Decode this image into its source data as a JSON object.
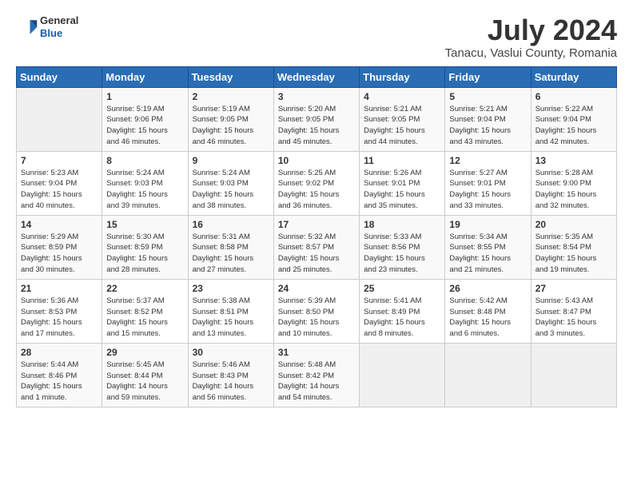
{
  "header": {
    "logo_general": "General",
    "logo_blue": "Blue",
    "month_year": "July 2024",
    "location": "Tanacu, Vaslui County, Romania"
  },
  "weekdays": [
    "Sunday",
    "Monday",
    "Tuesday",
    "Wednesday",
    "Thursday",
    "Friday",
    "Saturday"
  ],
  "weeks": [
    [
      {
        "day": "",
        "info": ""
      },
      {
        "day": "1",
        "info": "Sunrise: 5:19 AM\nSunset: 9:06 PM\nDaylight: 15 hours\nand 46 minutes."
      },
      {
        "day": "2",
        "info": "Sunrise: 5:19 AM\nSunset: 9:05 PM\nDaylight: 15 hours\nand 46 minutes."
      },
      {
        "day": "3",
        "info": "Sunrise: 5:20 AM\nSunset: 9:05 PM\nDaylight: 15 hours\nand 45 minutes."
      },
      {
        "day": "4",
        "info": "Sunrise: 5:21 AM\nSunset: 9:05 PM\nDaylight: 15 hours\nand 44 minutes."
      },
      {
        "day": "5",
        "info": "Sunrise: 5:21 AM\nSunset: 9:04 PM\nDaylight: 15 hours\nand 43 minutes."
      },
      {
        "day": "6",
        "info": "Sunrise: 5:22 AM\nSunset: 9:04 PM\nDaylight: 15 hours\nand 42 minutes."
      }
    ],
    [
      {
        "day": "7",
        "info": "Sunrise: 5:23 AM\nSunset: 9:04 PM\nDaylight: 15 hours\nand 40 minutes."
      },
      {
        "day": "8",
        "info": "Sunrise: 5:24 AM\nSunset: 9:03 PM\nDaylight: 15 hours\nand 39 minutes."
      },
      {
        "day": "9",
        "info": "Sunrise: 5:24 AM\nSunset: 9:03 PM\nDaylight: 15 hours\nand 38 minutes."
      },
      {
        "day": "10",
        "info": "Sunrise: 5:25 AM\nSunset: 9:02 PM\nDaylight: 15 hours\nand 36 minutes."
      },
      {
        "day": "11",
        "info": "Sunrise: 5:26 AM\nSunset: 9:01 PM\nDaylight: 15 hours\nand 35 minutes."
      },
      {
        "day": "12",
        "info": "Sunrise: 5:27 AM\nSunset: 9:01 PM\nDaylight: 15 hours\nand 33 minutes."
      },
      {
        "day": "13",
        "info": "Sunrise: 5:28 AM\nSunset: 9:00 PM\nDaylight: 15 hours\nand 32 minutes."
      }
    ],
    [
      {
        "day": "14",
        "info": "Sunrise: 5:29 AM\nSunset: 8:59 PM\nDaylight: 15 hours\nand 30 minutes."
      },
      {
        "day": "15",
        "info": "Sunrise: 5:30 AM\nSunset: 8:59 PM\nDaylight: 15 hours\nand 28 minutes."
      },
      {
        "day": "16",
        "info": "Sunrise: 5:31 AM\nSunset: 8:58 PM\nDaylight: 15 hours\nand 27 minutes."
      },
      {
        "day": "17",
        "info": "Sunrise: 5:32 AM\nSunset: 8:57 PM\nDaylight: 15 hours\nand 25 minutes."
      },
      {
        "day": "18",
        "info": "Sunrise: 5:33 AM\nSunset: 8:56 PM\nDaylight: 15 hours\nand 23 minutes."
      },
      {
        "day": "19",
        "info": "Sunrise: 5:34 AM\nSunset: 8:55 PM\nDaylight: 15 hours\nand 21 minutes."
      },
      {
        "day": "20",
        "info": "Sunrise: 5:35 AM\nSunset: 8:54 PM\nDaylight: 15 hours\nand 19 minutes."
      }
    ],
    [
      {
        "day": "21",
        "info": "Sunrise: 5:36 AM\nSunset: 8:53 PM\nDaylight: 15 hours\nand 17 minutes."
      },
      {
        "day": "22",
        "info": "Sunrise: 5:37 AM\nSunset: 8:52 PM\nDaylight: 15 hours\nand 15 minutes."
      },
      {
        "day": "23",
        "info": "Sunrise: 5:38 AM\nSunset: 8:51 PM\nDaylight: 15 hours\nand 13 minutes."
      },
      {
        "day": "24",
        "info": "Sunrise: 5:39 AM\nSunset: 8:50 PM\nDaylight: 15 hours\nand 10 minutes."
      },
      {
        "day": "25",
        "info": "Sunrise: 5:41 AM\nSunset: 8:49 PM\nDaylight: 15 hours\nand 8 minutes."
      },
      {
        "day": "26",
        "info": "Sunrise: 5:42 AM\nSunset: 8:48 PM\nDaylight: 15 hours\nand 6 minutes."
      },
      {
        "day": "27",
        "info": "Sunrise: 5:43 AM\nSunset: 8:47 PM\nDaylight: 15 hours\nand 3 minutes."
      }
    ],
    [
      {
        "day": "28",
        "info": "Sunrise: 5:44 AM\nSunset: 8:46 PM\nDaylight: 15 hours\nand 1 minute."
      },
      {
        "day": "29",
        "info": "Sunrise: 5:45 AM\nSunset: 8:44 PM\nDaylight: 14 hours\nand 59 minutes."
      },
      {
        "day": "30",
        "info": "Sunrise: 5:46 AM\nSunset: 8:43 PM\nDaylight: 14 hours\nand 56 minutes."
      },
      {
        "day": "31",
        "info": "Sunrise: 5:48 AM\nSunset: 8:42 PM\nDaylight: 14 hours\nand 54 minutes."
      },
      {
        "day": "",
        "info": ""
      },
      {
        "day": "",
        "info": ""
      },
      {
        "day": "",
        "info": ""
      }
    ]
  ]
}
